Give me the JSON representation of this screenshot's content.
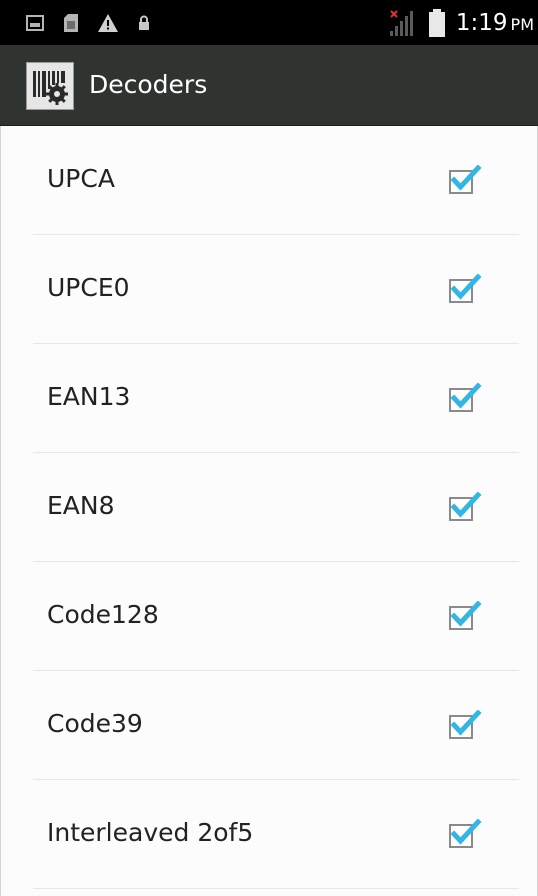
{
  "status_bar": {
    "time": "1:19",
    "ampm": "PM",
    "icons": [
      "image-icon",
      "sim-card-icon",
      "warning-icon",
      "lock-icon",
      "signal-icon",
      "battery-icon"
    ]
  },
  "action_bar": {
    "title": "Decoders",
    "icon": "barcode-settings-icon"
  },
  "decoders": [
    {
      "name": "UPCA",
      "checked": true
    },
    {
      "name": "UPCE0",
      "checked": true
    },
    {
      "name": "EAN13",
      "checked": true
    },
    {
      "name": "EAN8",
      "checked": true
    },
    {
      "name": "Code128",
      "checked": true
    },
    {
      "name": "Code39",
      "checked": true
    },
    {
      "name": "Interleaved 2of5",
      "checked": true
    }
  ],
  "colors": {
    "check": "#33b5e5",
    "action_bar": "#2f3431",
    "status_bar": "#000000",
    "background": "#fcfcfc"
  }
}
